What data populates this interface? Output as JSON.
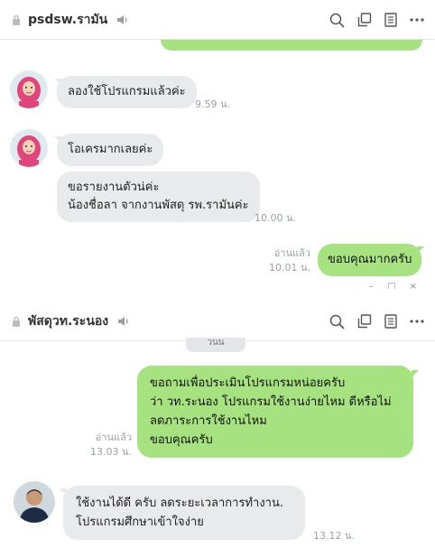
{
  "chat1": {
    "title": "psdsw.รามัน",
    "messages": [
      {
        "text": "ลองใช้โปรแกรมแล้วค่ะ",
        "time": "9.59 น."
      },
      {
        "text": "โอเครมากเลยค่ะ"
      },
      {
        "lines": [
          "ขอรายงานตัวน่ค่ะ",
          "น้องชื่อลา จากงานพัสดุ รพ.รามันค่ะ"
        ],
        "time": "10.00 น."
      },
      {
        "text": "ขอบคุณมากครับ",
        "read": "อ่านแล้ว",
        "time": "10.01 น."
      }
    ]
  },
  "chat2": {
    "title": "พัสดุวท.ระนอง",
    "partial_label": "วนน",
    "messages": [
      {
        "lines": [
          "ขอถามเพื่อประเมินโปรแกรมหน่อยครับ",
          "ว่า วท.ระนอง โปรแกรมใช้งานง่ายไหม ดีหรือไม่",
          "ลดภาระการใช้งานไหม",
          "ขอบคุณครับ"
        ],
        "read": "อ่านแล้ว",
        "time": "13.03 น."
      },
      {
        "lines": [
          "ใช้งานได้ดี ครับ ลดระยะเวลาการทำงาน.",
          "โปรแกรมศึกษาเข้าใจง่าย"
        ],
        "time": "13.12 น."
      }
    ]
  },
  "icons": [
    "lock-icon",
    "speaker-icon",
    "search-icon",
    "copy-icon",
    "notes-icon",
    "more-icon"
  ],
  "colors": {
    "incoming_bubble": "#e9eaec",
    "outgoing_bubble": "#a6e280",
    "timestamp": "#9aa0a6"
  }
}
